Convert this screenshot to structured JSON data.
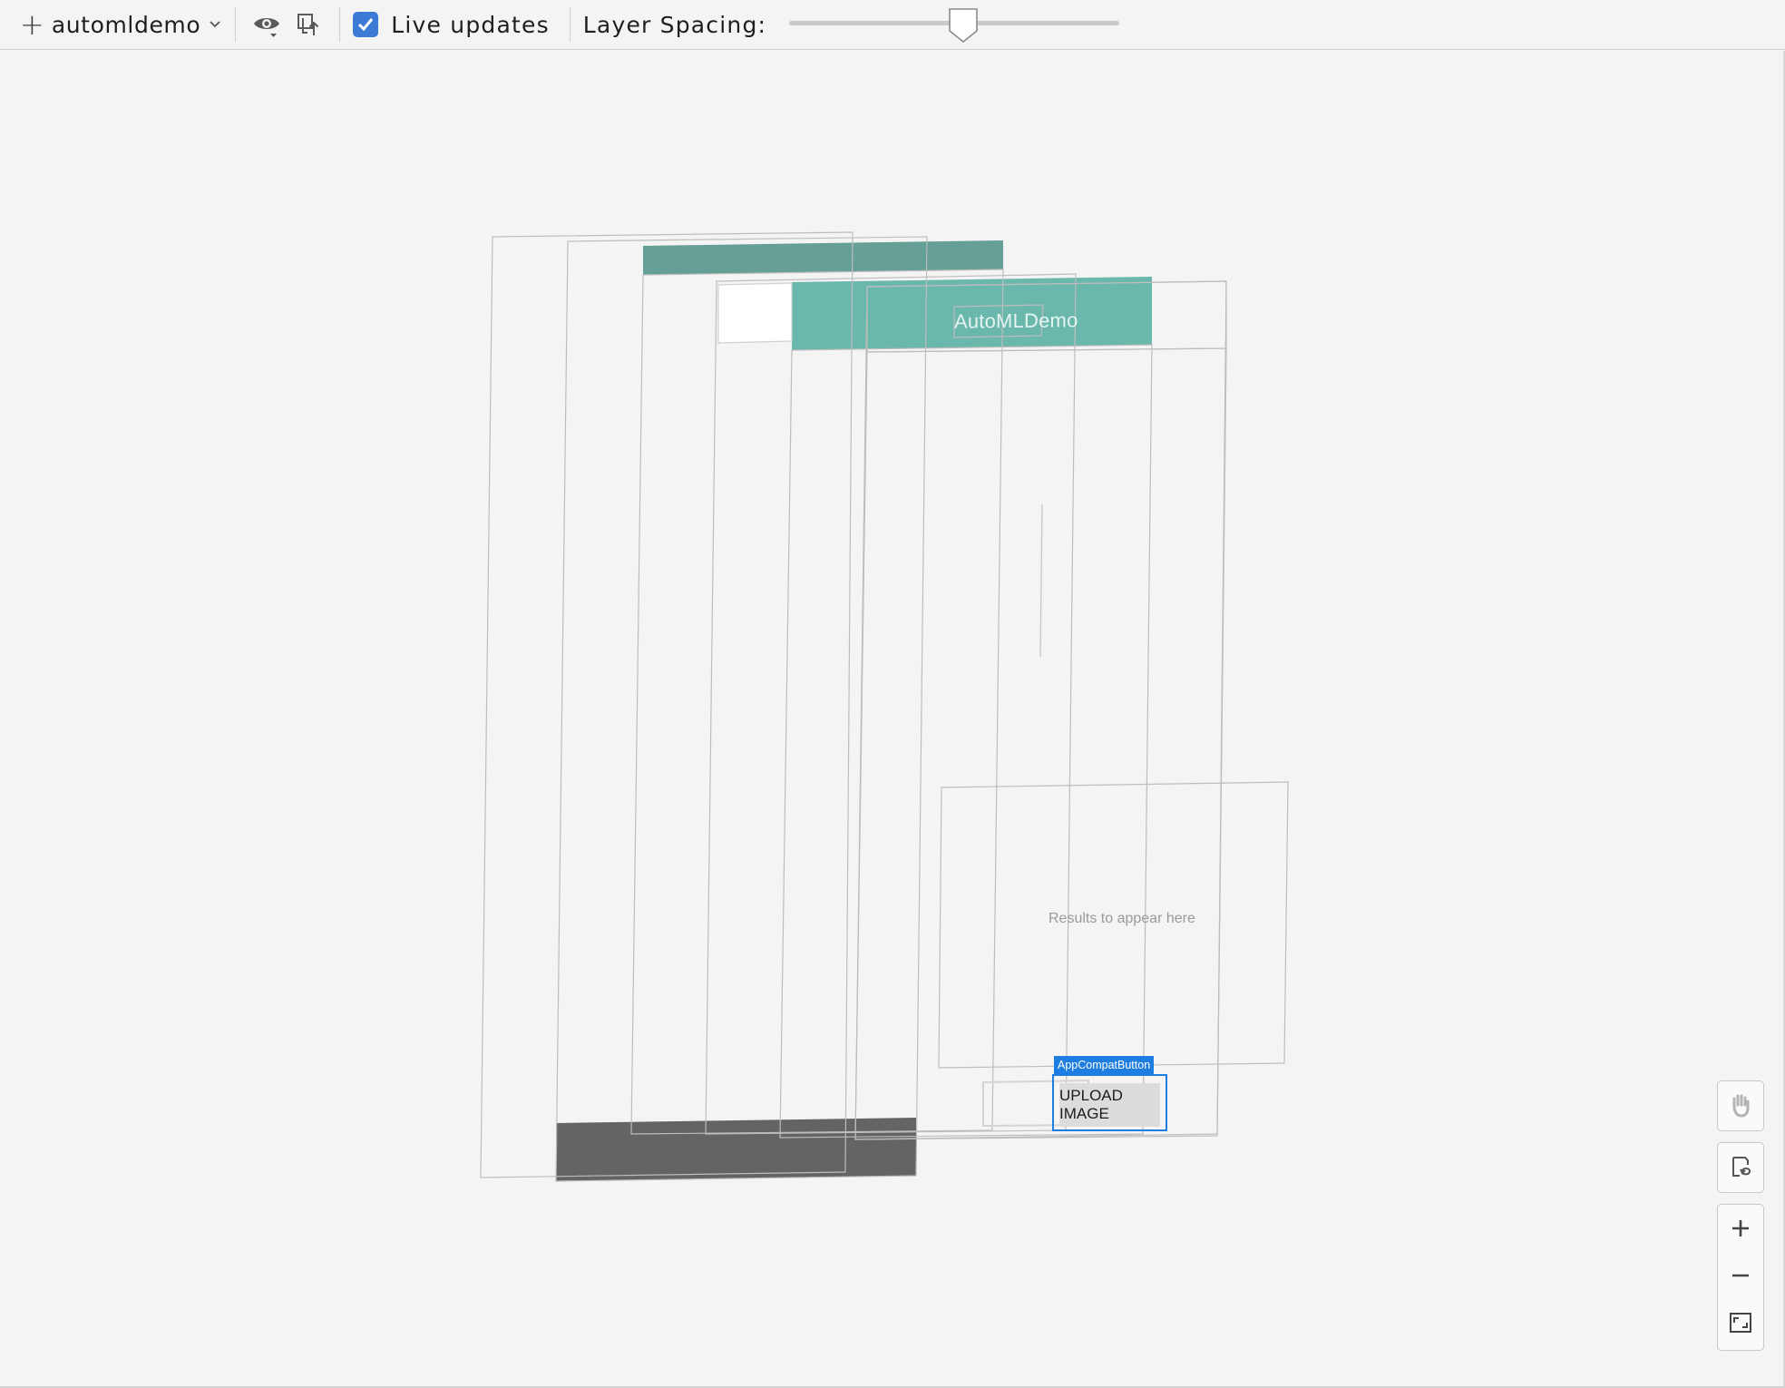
{
  "toolbar": {
    "process_name": "automldemo",
    "live_updates_label": "Live updates",
    "live_updates_checked": true,
    "layer_spacing_label": "Layer Spacing:",
    "layer_spacing_value": 0.53,
    "icons": {
      "add": "plus-icon",
      "dropdown": "chevron-down-icon",
      "view_options": "eye-icon",
      "export": "export-icon",
      "checkbox": "checkmark-icon"
    }
  },
  "canvas": {
    "app_title": "AutoMLDemo",
    "results_placeholder": "Results to appear here",
    "selected_component": "AppCompatButton",
    "selected_button_label": "UPLOAD IMAGE",
    "colors": {
      "action_bar": "#62b3a8",
      "status_bar": "#5e9a90",
      "nav_bar": "#646464",
      "selection": "#1d7de0",
      "background": "#f4f4f4"
    }
  },
  "controls": {
    "pan": "hand-icon",
    "reset": "reset-view-icon",
    "zoom_in": "zoom-in-icon",
    "zoom_out": "zoom-out-icon",
    "fit": "fit-screen-icon"
  }
}
